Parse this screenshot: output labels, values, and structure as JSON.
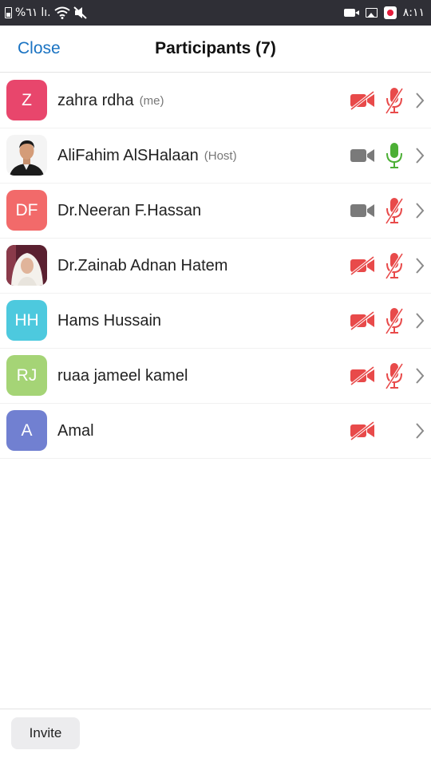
{
  "status_bar": {
    "battery_text": "%٦١",
    "signal_text": "lı.",
    "time": "٨:١١"
  },
  "header": {
    "close_label": "Close",
    "title": "Participants (7)"
  },
  "participants": [
    {
      "name": "zahra rdha",
      "role": "(me)",
      "initials": "Z",
      "avatar_color": "#e8466c",
      "video_muted": true,
      "audio": "muted"
    },
    {
      "name": "AliFahim AlSHalaan",
      "role": "(Host)",
      "initials": "",
      "avatar_color": "#ffffff",
      "avatar_photo": "man-portrait",
      "video_muted": false,
      "audio": "active"
    },
    {
      "name": "Dr.Neeran F.Hassan",
      "role": "",
      "initials": "DF",
      "avatar_color": "#f26a6a",
      "video_muted": false,
      "audio": "muted"
    },
    {
      "name": "Dr.Zainab Adnan Hatem",
      "role": "",
      "initials": "",
      "avatar_color": "#6b2a3a",
      "avatar_photo": "woman-portrait",
      "video_muted": true,
      "audio": "muted"
    },
    {
      "name": "Hams Hussain",
      "role": "",
      "initials": "HH",
      "avatar_color": "#4dc9de",
      "video_muted": true,
      "audio": "muted"
    },
    {
      "name": "ruaa jameel kamel",
      "role": "",
      "initials": "RJ",
      "avatar_color": "#a5d476",
      "video_muted": true,
      "audio": "muted"
    },
    {
      "name": "Amal",
      "role": "",
      "initials": "A",
      "avatar_color": "#7180d1",
      "video_muted": true,
      "audio": "none"
    }
  ],
  "footer": {
    "invite_label": "Invite"
  },
  "colors": {
    "accent": "#1a73c2",
    "muted_red": "#e84a4a",
    "active_green": "#4caf35",
    "icon_gray": "#7a7a7a"
  }
}
